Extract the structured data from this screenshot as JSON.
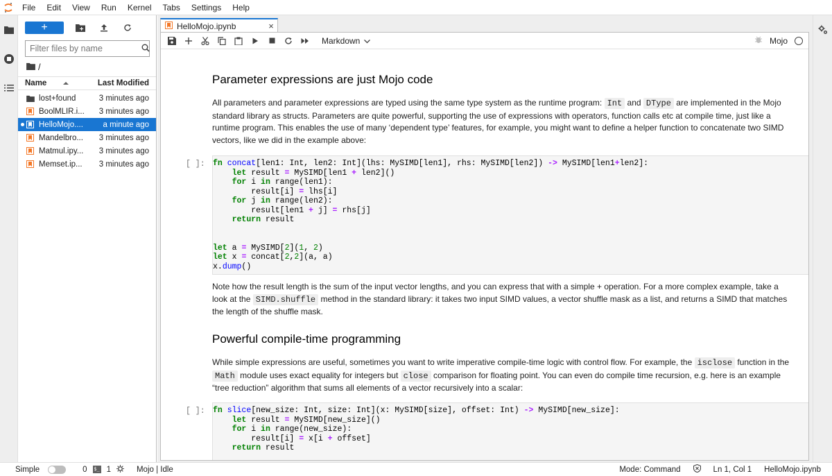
{
  "menubar": {
    "items": [
      "File",
      "Edit",
      "View",
      "Run",
      "Kernel",
      "Tabs",
      "Settings",
      "Help"
    ]
  },
  "filebrowser": {
    "new_label": "+",
    "search_placeholder": "Filter files by name",
    "breadcrumb": "/",
    "header_name": "Name",
    "header_modified": "Last Modified",
    "files": [
      {
        "name": "lost+found",
        "modified": "3 minutes ago",
        "type": "folder"
      },
      {
        "name": "BoolMLIR.i...",
        "modified": "3 minutes ago",
        "type": "notebook"
      },
      {
        "name": "HelloMojo....",
        "modified": "a minute ago",
        "type": "notebook",
        "selected": true
      },
      {
        "name": "Mandelbro...",
        "modified": "3 minutes ago",
        "type": "notebook"
      },
      {
        "name": "Matmul.ipy...",
        "modified": "3 minutes ago",
        "type": "notebook"
      },
      {
        "name": "Memset.ip...",
        "modified": "3 minutes ago",
        "type": "notebook"
      }
    ]
  },
  "tab": {
    "label": "HelloMojo.ipynb",
    "close": "×"
  },
  "toolbar": {
    "cell_type": "Markdown",
    "kernel": "Mojo"
  },
  "notebook": {
    "h1": "Parameter expressions are just Mojo code",
    "p1": {
      "a": "All parameters and parameter expressions are typed using the same type system as the runtime program: ",
      "c1": "Int",
      "b": " and ",
      "c2": "DType",
      "c": " are implemented in the Mojo standard library as structs. Parameters are quite powerful, supporting the use of expressions with operators, function calls etc at compile time, just like a runtime program. This enables the use of many ‘dependent type’ features, for example, you might want to define a helper function to concatenate two SIMD vectors, like we did in the example above:"
    },
    "prompt": "[ ]:",
    "p2": {
      "a": "Note how the result length is the sum of the input vector lengths, and you can express that with a simple + operation. For a more complex example, take a look at the ",
      "c1": "SIMD.shuffle",
      "b": " method in the standard library: it takes two input SIMD values, a vector shuffle mask as a list, and returns a SIMD that matches the length of the shuffle mask."
    },
    "h2": "Powerful compile-time programming",
    "p3": {
      "a": "While simple expressions are useful, sometimes you want to write imperative compile-time logic with control flow. For example, the ",
      "c1": "isclose",
      "b": " function in the ",
      "c2": "Math",
      "c": " module uses exact equality for integers but ",
      "c3": "close",
      "d": " comparison for floating point. You can even do compile time recursion, e.g. here is an example “tree reduction” algorithm that sums all elements of a vector recursively into a scalar:"
    }
  },
  "statusbar": {
    "simple": "Simple",
    "count0": "0",
    "count1": "1",
    "kernel_status": "Mojo | Idle",
    "mode": "Mode: Command",
    "position": "Ln 1, Col 1",
    "filename": "HelloMojo.ipynb"
  }
}
